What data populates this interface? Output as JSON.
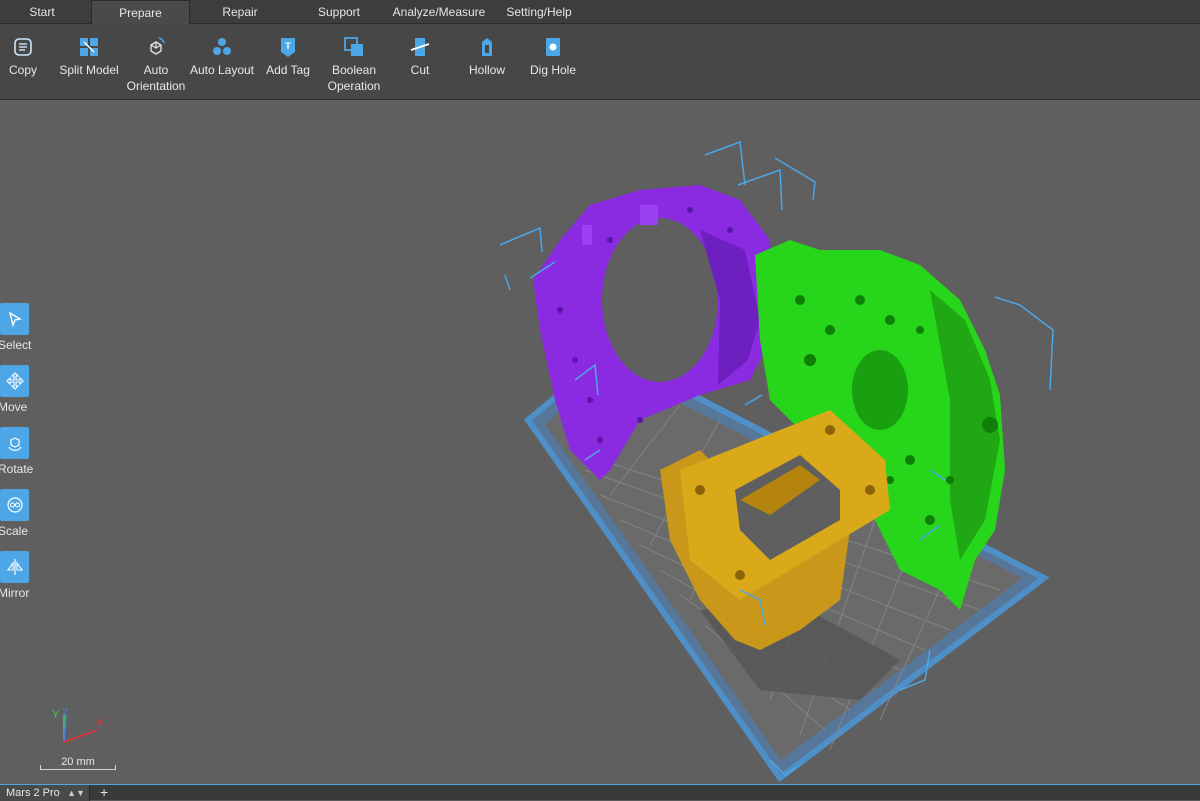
{
  "tabs": {
    "start": "Start",
    "prepare": "Prepare",
    "repair": "Repair",
    "support": "Support",
    "analyze": "Analyze/Measure",
    "setting": "Setting/Help"
  },
  "ribbon": {
    "copy": "Copy",
    "split_model": "Split Model",
    "auto_orientation": "Auto\nOrientation",
    "auto_layout": "Auto Layout",
    "add_tag": "Add Tag",
    "boolean_operation": "Boolean\nOperation",
    "cut": "Cut",
    "hollow": "Hollow",
    "dig_hole": "Dig Hole"
  },
  "side_tools": {
    "select": "Select",
    "move": "Move",
    "rotate": "Rotate",
    "scale": "Scale",
    "mirror": "Mirror"
  },
  "axes": {
    "y": "Y",
    "z": "Z",
    "x": "X"
  },
  "scale_label": "20 mm",
  "printer_tab": "Mars 2 Pro",
  "add_tab_symbol": "+",
  "colors": {
    "accent": "#4da6e6",
    "model_purple": "#8a2be2",
    "model_green": "#22cc11",
    "model_yellow": "#d9a919",
    "plate": "#4f8fc8"
  }
}
